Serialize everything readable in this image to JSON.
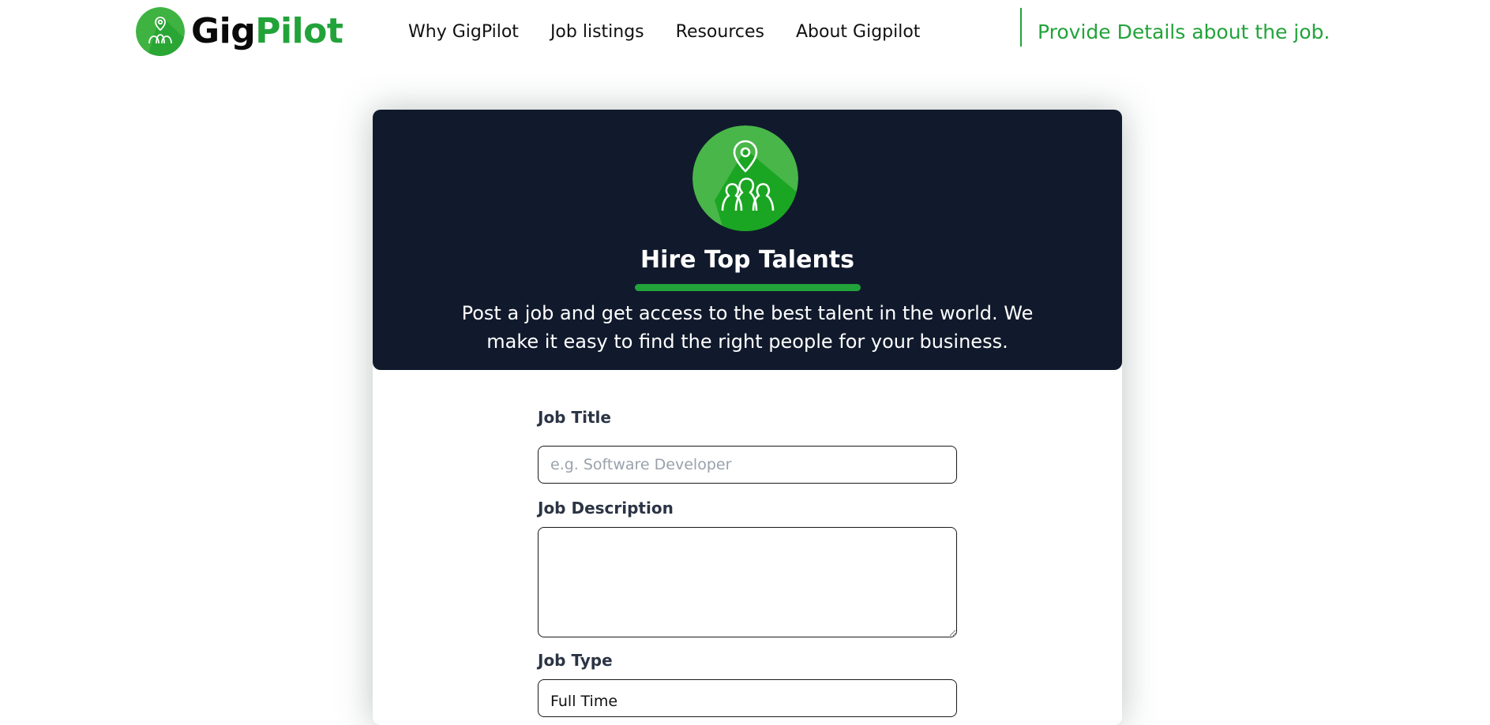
{
  "brand": {
    "name_part1": "Gig",
    "name_part2": "Pilot",
    "accent_color": "#22a33a",
    "icon": "location-people-icon"
  },
  "nav": {
    "items": [
      {
        "label": "Why GigPilot"
      },
      {
        "label": "Job listings"
      },
      {
        "label": "Resources"
      },
      {
        "label": "About Gigpilot"
      }
    ]
  },
  "header": {
    "tagline": "Provide Details about the job."
  },
  "hero": {
    "title": "Hire Top Talents",
    "description": "Post a job and get access to the best talent in the world. We make it easy to find the right people for your business.",
    "icon": "location-people-icon",
    "background_color": "#111a2c"
  },
  "form": {
    "job_title": {
      "label": "Job Title",
      "value": "",
      "placeholder": "e.g. Software Developer"
    },
    "job_description": {
      "label": "Job Description",
      "value": ""
    },
    "job_type": {
      "label": "Job Type",
      "selected": "Full Time"
    }
  }
}
